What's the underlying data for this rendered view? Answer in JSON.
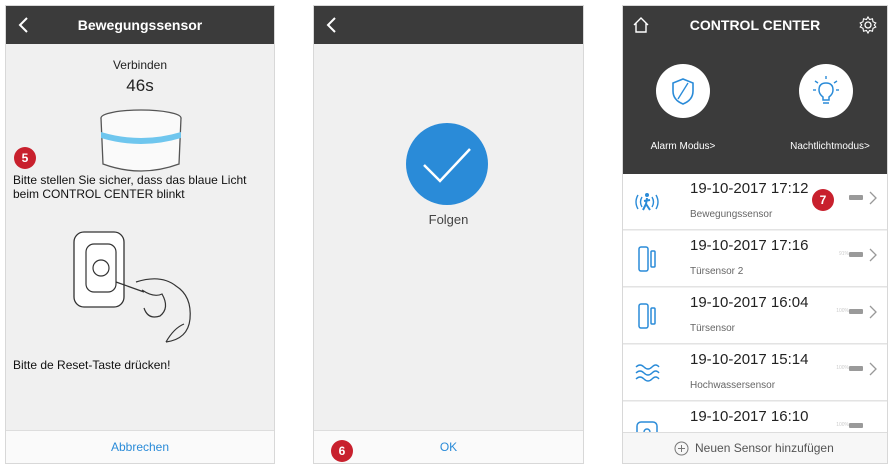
{
  "panel1": {
    "title": "Bewegungssensor",
    "connect_label": "Verbinden",
    "countdown": "46s",
    "instruction1": "Bitte stellen Sie sicher, dass das blaue Licht beim CONTROL CENTER blinkt",
    "instruction2": "Bitte de Reset-Taste drücken!",
    "cancel_label": "Abbrechen",
    "badge": "5"
  },
  "panel2": {
    "status_text": "Folgen",
    "ok_label": "OK",
    "badge": "6"
  },
  "panel3": {
    "title": "CONTROL CENTER",
    "alarm_label": "Alarm Modus>",
    "nightlight_label": "Nachtlichtmodus>",
    "badge": "7",
    "add_label": "Neuen Sensor hinzufügen",
    "sensors": [
      {
        "time": "19-10-2017 17:12",
        "name": "Bewegungssensor",
        "battery": "",
        "icon": "motion-icon"
      },
      {
        "time": "19-10-2017 17:16",
        "name": "Türsensor 2",
        "battery": "91%",
        "icon": "door-sensor-icon"
      },
      {
        "time": "19-10-2017 16:04",
        "name": "Türsensor",
        "battery": "100%",
        "icon": "door-sensor-icon"
      },
      {
        "time": "19-10-2017 15:14",
        "name": "Hochwassersensor",
        "battery": "100%",
        "icon": "water-icon"
      },
      {
        "time": "19-10-2017 16:10",
        "name": "",
        "battery": "100%",
        "icon": "sensor-icon"
      }
    ]
  },
  "colors": {
    "topbar": "#3b3b3b",
    "accent_blue": "#2a8bd8",
    "badge_red": "#c8202d"
  }
}
